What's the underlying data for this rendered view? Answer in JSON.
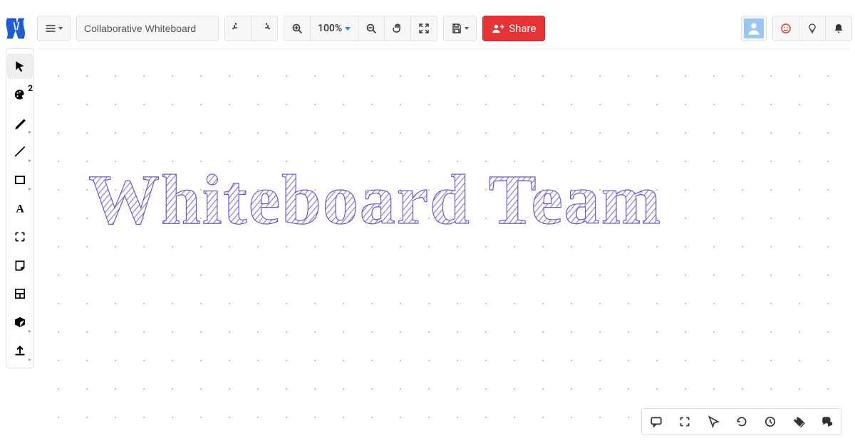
{
  "colors": {
    "accent": "#e63333",
    "zoom_caret": "#1a8cff",
    "logo": "#1e5bd6",
    "canvas_text": "#7256c9"
  },
  "header": {
    "title": "Collaborative Whiteboard",
    "zoom_label": "100%",
    "share_label": "Share",
    "icons": {
      "menu": "menu-icon",
      "undo": "undo-icon",
      "redo": "redo-icon",
      "zoom_in": "zoom-in-icon",
      "zoom_out": "zoom-out-icon",
      "pan": "hand-icon",
      "fit": "expand-icon",
      "save": "save-icon",
      "avatar": "avatar-icon",
      "emoji": "smile-icon",
      "idea": "lightbulb-icon",
      "notifications": "bell-icon"
    }
  },
  "left_tools": [
    {
      "name": "select-tool",
      "icon": "cursor-icon",
      "selected": true,
      "more": false
    },
    {
      "name": "palette-tool",
      "icon": "palette-icon",
      "badge": "2",
      "more": false
    },
    {
      "name": "pen-tool",
      "icon": "pencil-icon",
      "more": true
    },
    {
      "name": "line-tool",
      "icon": "line-icon",
      "more": true
    },
    {
      "name": "shape-tool",
      "icon": "rect-icon",
      "more": true
    },
    {
      "name": "text-tool",
      "icon": "text-icon",
      "more": false
    },
    {
      "name": "frame-tool",
      "icon": "frame-icon",
      "more": false
    },
    {
      "name": "note-tool",
      "icon": "note-icon",
      "more": false
    },
    {
      "name": "template-tool",
      "icon": "layout-icon",
      "more": false
    },
    {
      "name": "cube-tool",
      "icon": "cube-icon",
      "more": true
    },
    {
      "name": "upload-tool",
      "icon": "upload-icon",
      "more": true
    }
  ],
  "canvas": {
    "main_text": "Whiteboard Team"
  },
  "bottom_bar": [
    {
      "name": "comment-tool",
      "icon": "chat-icon"
    },
    {
      "name": "presentation-tool",
      "icon": "focus-icon"
    },
    {
      "name": "follow-tool",
      "icon": "pointer-icon"
    },
    {
      "name": "history-tool",
      "icon": "history-icon"
    },
    {
      "name": "timer-tool",
      "icon": "clock-icon"
    },
    {
      "name": "tag-tool",
      "icon": "tags-icon"
    },
    {
      "name": "chat-tool",
      "icon": "comments-icon"
    }
  ]
}
